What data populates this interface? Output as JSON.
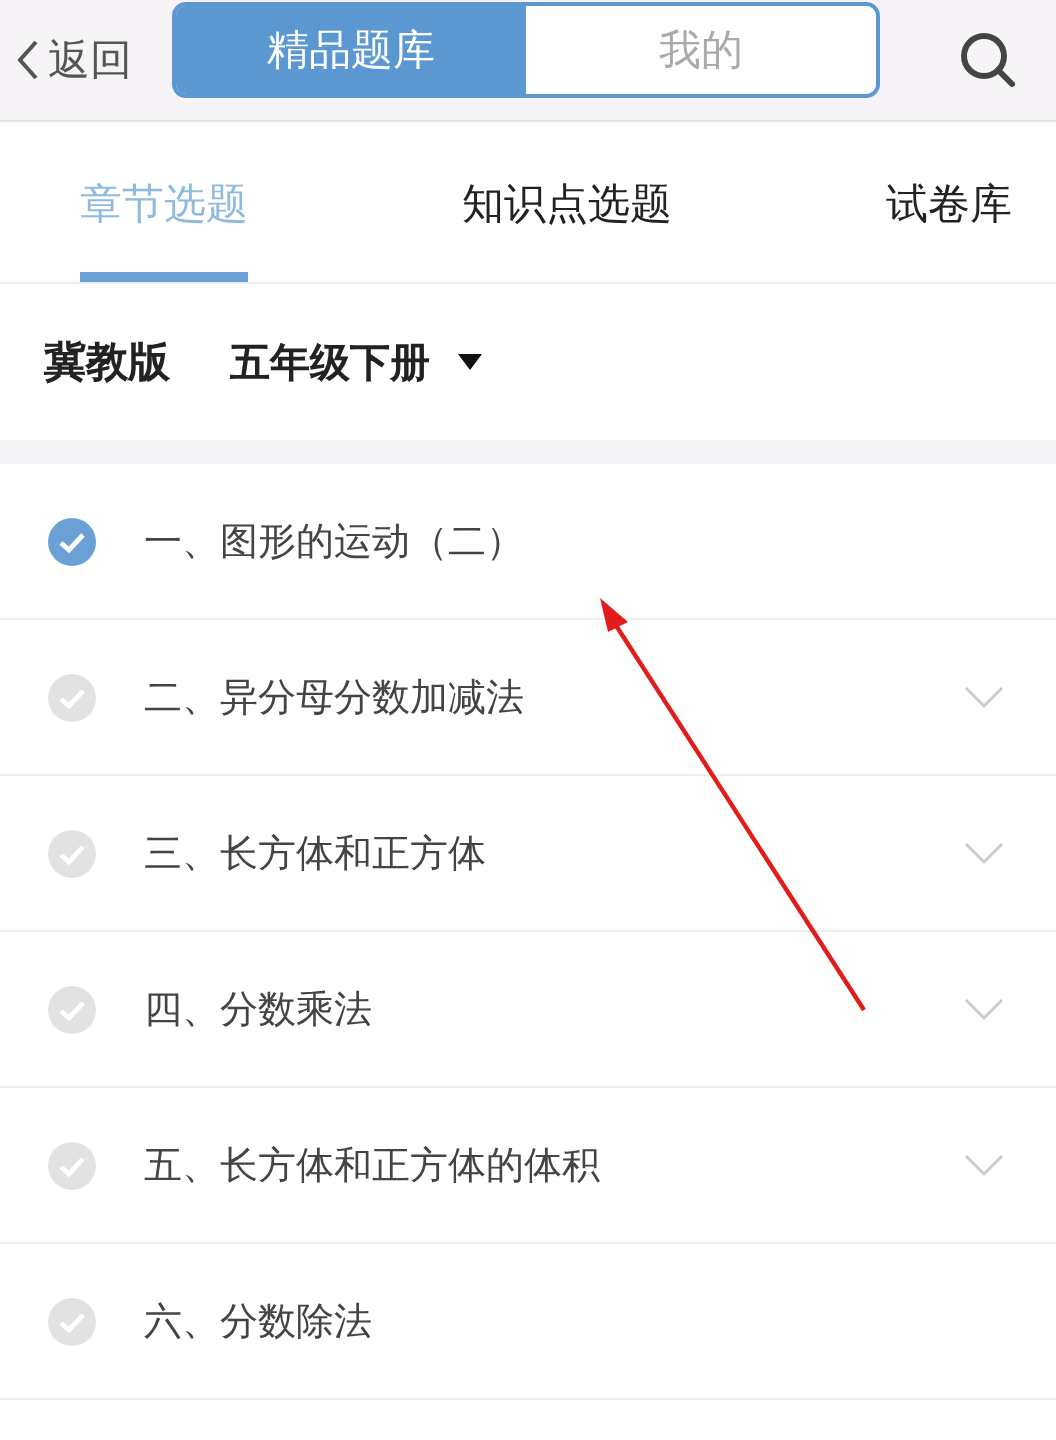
{
  "nav": {
    "back": "返回",
    "segments": [
      {
        "label": "精品题库",
        "selected": true
      },
      {
        "label": "我的",
        "selected": false
      }
    ]
  },
  "tabs": [
    {
      "label": "章节选题",
      "selected": true
    },
    {
      "label": "知识点选题",
      "selected": false
    },
    {
      "label": "试卷库",
      "selected": false
    }
  ],
  "filter": {
    "edition": "冀教版",
    "grade": "五年级下册"
  },
  "chapters": [
    {
      "title": "一、图形的运动（二）",
      "checked": true,
      "expandable": false
    },
    {
      "title": "二、异分母分数加减法",
      "checked": false,
      "expandable": true
    },
    {
      "title": "三、长方体和正方体",
      "checked": false,
      "expandable": true
    },
    {
      "title": "四、分数乘法",
      "checked": false,
      "expandable": true
    },
    {
      "title": "五、长方体和正方体的体积",
      "checked": false,
      "expandable": true
    },
    {
      "title": "六、分数除法",
      "checked": false,
      "expandable": false
    }
  ]
}
